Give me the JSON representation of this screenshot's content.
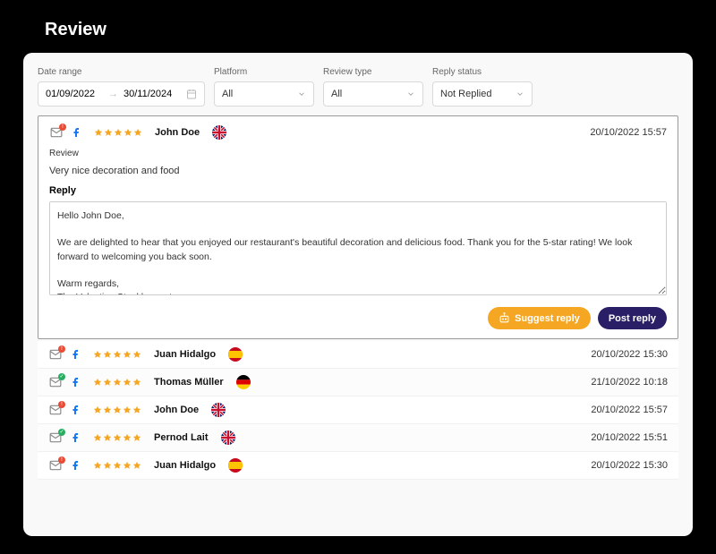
{
  "page_title": "Review",
  "filters": {
    "date_range_label": "Date range",
    "date_start": "01/09/2022",
    "date_end": "30/11/2024",
    "platform_label": "Platform",
    "platform_value": "All",
    "review_type_label": "Review type",
    "review_type_value": "All",
    "reply_status_label": "Reply status",
    "reply_status_value": "Not Replied"
  },
  "expanded": {
    "reviewer": "John Doe",
    "timestamp": "20/10/2022 15:57",
    "stars": 5,
    "review_label": "Review",
    "review_text": "Very nice decoration and food",
    "reply_label": "Reply",
    "reply_text": "Hello John Doe,\n\nWe are delighted to hear that you enjoyed our restaurant's beautiful decoration and delicious food. Thank you for the 5-star rating! We look forward to welcoming you back soon.\n\nWarm regards,\nThe Valentine Steakhouse team",
    "suggest_label": "Suggest reply",
    "post_label": "Post reply",
    "flag": "uk",
    "status_badge": "red"
  },
  "list": [
    {
      "reviewer": "Juan Hidalgo",
      "timestamp": "20/10/2022 15:30",
      "stars": 5,
      "flag": "es",
      "status_badge": "red"
    },
    {
      "reviewer": "Thomas Müller",
      "timestamp": "21/10/2022 10:18",
      "stars": 5,
      "flag": "de",
      "status_badge": "green"
    },
    {
      "reviewer": "John Doe",
      "timestamp": "20/10/2022 15:57",
      "stars": 5,
      "flag": "uk",
      "status_badge": "red"
    },
    {
      "reviewer": "Pernod Lait",
      "timestamp": "20/10/2022 15:51",
      "stars": 5,
      "flag": "uk",
      "status_badge": "green"
    },
    {
      "reviewer": "Juan Hidalgo",
      "timestamp": "20/10/2022 15:30",
      "stars": 5,
      "flag": "es",
      "status_badge": "red"
    }
  ]
}
